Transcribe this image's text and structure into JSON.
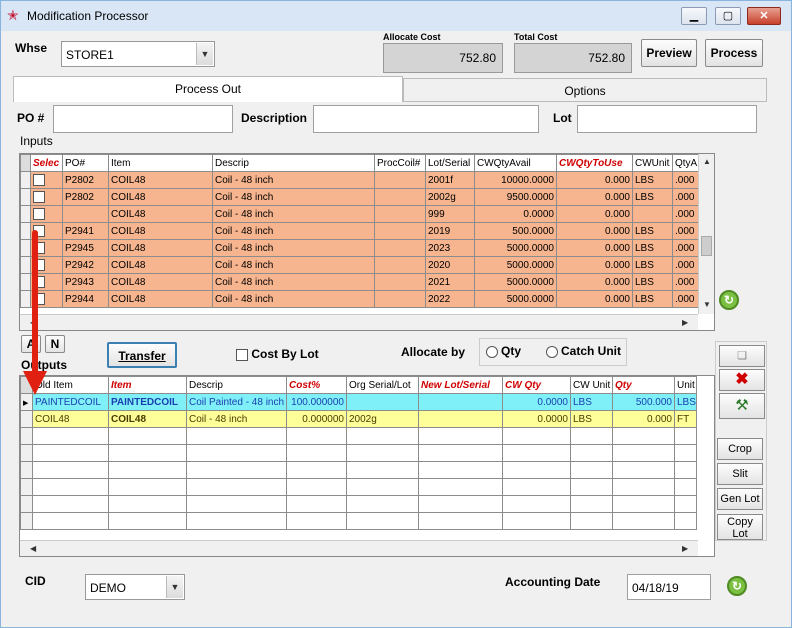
{
  "window": {
    "title": "Modification Processor",
    "min": "▁",
    "max": "▢",
    "close": "✕"
  },
  "header": {
    "whse_label": "Whse",
    "whse_value": "STORE1",
    "allocate_cost_label": "Allocate Cost",
    "allocate_cost_value": "752.80",
    "total_cost_label": "Total Cost",
    "total_cost_value": "752.80",
    "preview": "Preview",
    "process": "Process"
  },
  "tabs": [
    {
      "label": "Process Out"
    },
    {
      "label": "Options"
    }
  ],
  "filters": {
    "po_label": "PO #",
    "desc_label": "Description",
    "lot_label": "Lot",
    "inputs_label": "Inputs"
  },
  "inputs_table": {
    "columns": [
      "Selec",
      "PO#",
      "Item",
      "Descrip",
      "ProcCoil#",
      "Lot/Serial",
      "CWQtyAvail",
      "CWQtyToUse",
      "CWUnit",
      "QtyA"
    ],
    "rows": [
      {
        "po": "P2802",
        "item": "COIL48",
        "desc": "Coil - 48 inch",
        "proc": "",
        "lot": "2001f",
        "cwavail": "10000.0000",
        "cwuse": "0.000",
        "unit": "LBS",
        "qty": ".000"
      },
      {
        "po": "P2802",
        "item": "COIL48",
        "desc": "Coil - 48 inch",
        "proc": "",
        "lot": "2002g",
        "cwavail": "9500.0000",
        "cwuse": "0.000",
        "unit": "LBS",
        "qty": ".000"
      },
      {
        "po": "",
        "item": "COIL48",
        "desc": "Coil - 48 inch",
        "proc": "",
        "lot": "999",
        "cwavail": "0.0000",
        "cwuse": "0.000",
        "unit": "",
        "qty": ".000"
      },
      {
        "po": "P2941",
        "item": "COIL48",
        "desc": "Coil - 48 inch",
        "proc": "",
        "lot": "2019",
        "cwavail": "500.0000",
        "cwuse": "0.000",
        "unit": "LBS",
        "qty": ".000"
      },
      {
        "po": "P2945",
        "item": "COIL48",
        "desc": "Coil - 48 inch",
        "proc": "",
        "lot": "2023",
        "cwavail": "5000.0000",
        "cwuse": "0.000",
        "unit": "LBS",
        "qty": ".000"
      },
      {
        "po": "P2942",
        "item": "COIL48",
        "desc": "Coil - 48 inch",
        "proc": "",
        "lot": "2020",
        "cwavail": "5000.0000",
        "cwuse": "0.000",
        "unit": "LBS",
        "qty": ".000"
      },
      {
        "po": "P2943",
        "item": "COIL48",
        "desc": "Coil - 48 inch",
        "proc": "",
        "lot": "2021",
        "cwavail": "5000.0000",
        "cwuse": "0.000",
        "unit": "LBS",
        "qty": ".000"
      },
      {
        "po": "P2944",
        "item": "COIL48",
        "desc": "Coil - 48 inch",
        "proc": "",
        "lot": "2022",
        "cwavail": "5000.0000",
        "cwuse": "0.000",
        "unit": "LBS",
        "qty": ".000"
      }
    ]
  },
  "mid": {
    "a_btn": "A",
    "n_btn": "N",
    "outputs_label": "Outputs",
    "transfer": "Transfer",
    "cost_by_lot": "Cost By Lot",
    "allocate_by": "Allocate by",
    "qty_opt": "Qty",
    "catch_opt": "Catch Unit"
  },
  "outputs_table": {
    "columns": [
      "Old Item",
      "Item",
      "Descrip",
      "Cost%",
      "Org Serial/Lot",
      "New Lot/Serial",
      "CW Qty",
      "CW Unit",
      "Qty",
      "Unit"
    ],
    "rows": [
      {
        "old": "PAINTEDCOIL",
        "item": "PAINTEDCOIL",
        "desc": "Coil Painted - 48 inch",
        "cost": "100.000000",
        "org": "",
        "newlot": "",
        "cwqty": "0.0000",
        "cwunit": "LBS",
        "qty": "500.000",
        "unit": "LBS"
      },
      {
        "old": "COIL48",
        "item": "COIL48",
        "desc": "Coil - 48 inch",
        "cost": "0.000000",
        "org": "2002g",
        "newlot": "",
        "cwqty": "0.0000",
        "cwunit": "LBS",
        "qty": "0.000",
        "unit": "FT"
      }
    ]
  },
  "side": {
    "crop": "Crop",
    "slit": "Slit",
    "gen_lot": "Gen Lot",
    "copy_lot": "Copy Lot"
  },
  "footer": {
    "cid_label": "CID",
    "cid_value": "DEMO",
    "acct_date_label": "Accounting Date",
    "acct_date_value": "04/18/19"
  },
  "colors": {
    "input_row": "#f7b58f",
    "output_row1": "#80f0f8",
    "output_row2": "#ffff99",
    "arrow": "#e02010"
  }
}
